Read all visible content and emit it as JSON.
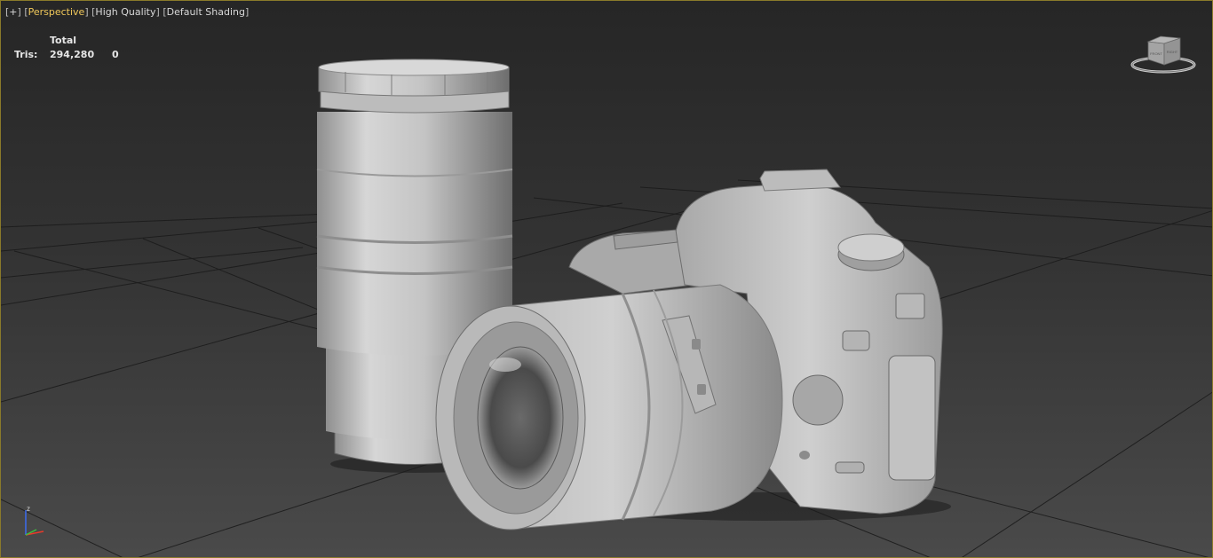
{
  "viewport": {
    "label": {
      "plus": "+",
      "view": "Perspective",
      "quality": "High Quality",
      "shading": "Default Shading"
    },
    "stats": {
      "header": "Total",
      "tris_label": "Tris:",
      "tris_value": "294,280",
      "selected_value": "0"
    },
    "viewcube": {
      "icon": "viewcube-icon",
      "faces": [
        "FRONT",
        "RIGHT"
      ]
    },
    "axis": {
      "icon": "axis-tripod-icon",
      "up": "z"
    },
    "scene_objects": [
      "lens-on-table",
      "camera-body",
      "mounted-lens",
      "ground-grid"
    ],
    "colors": {
      "active_border": "#8a7a2a",
      "active_view": "#f0c85a",
      "model": "#c9c9c9",
      "grid": "#1a1a1a"
    }
  }
}
